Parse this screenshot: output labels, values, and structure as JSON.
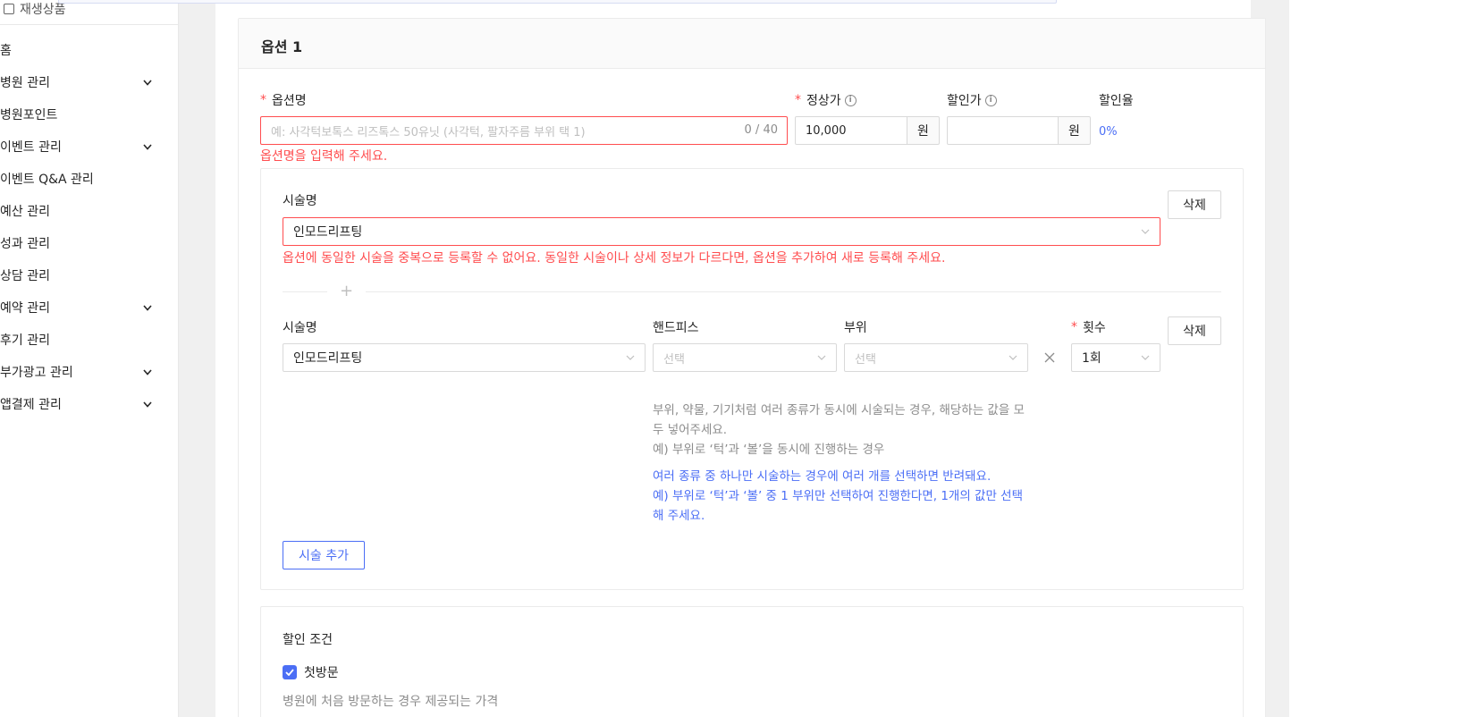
{
  "sidebar": {
    "top_label": "재생상품",
    "items": [
      {
        "label": "홈",
        "expandable": false
      },
      {
        "label": "병원 관리",
        "expandable": true
      },
      {
        "label": "병원포인트",
        "expandable": false
      },
      {
        "label": "이벤트 관리",
        "expandable": true
      },
      {
        "label": "이벤트 Q&A 관리",
        "expandable": false
      },
      {
        "label": "예산 관리",
        "expandable": false
      },
      {
        "label": "성과 관리",
        "expandable": false
      },
      {
        "label": "상담 관리",
        "expandable": false
      },
      {
        "label": "예약 관리",
        "expandable": true
      },
      {
        "label": "후기 관리",
        "expandable": false
      },
      {
        "label": "부가광고 관리",
        "expandable": true
      },
      {
        "label": "앱결제 관리",
        "expandable": true
      }
    ]
  },
  "option": {
    "title": "옵션 1",
    "name_label": "옵션명",
    "name_placeholder": "예: 사각턱보톡스 리즈톡스 50유닛 (사각턱, 팔자주름 부위 택 1)",
    "name_counter": "0 / 40",
    "name_error": "옵션명을 입력해 주세요.",
    "price_label": "정상가",
    "price_value": "10,000",
    "price_unit": "원",
    "discount_label": "할인가",
    "discount_value": "",
    "discount_unit": "원",
    "rate_label": "할인율",
    "rate_value": "0%"
  },
  "procedure1": {
    "label": "시술명",
    "value": "인모드리프팅",
    "error": "옵션에 동일한 시술을 중복으로 등록할 수 없어요. 동일한 시술이나 상세 정보가 다르다면, 옵션을 추가하여 새로 등록해 주세요.",
    "delete_label": "삭제"
  },
  "procedure2": {
    "label": "시술명",
    "value": "인모드리프팅",
    "handpiece_label": "핸드피스",
    "handpiece_placeholder": "선택",
    "area_label": "부위",
    "area_placeholder": "선택",
    "count_label": "횟수",
    "count_value": "1회",
    "delete_label": "삭제"
  },
  "hints": {
    "gray1": "부위, 약물, 기기처럼 여러 종류가 동시에 시술되는 경우, 해당하는 값을 모두 넣어주세요.",
    "gray2": "예) 부위로 ‘턱’과 ‘볼’을 동시에 진행하는 경우",
    "blue1": "여러 종류 중 하나만 시술하는 경우에 여러 개를 선택하면 반려돼요.",
    "blue2": "예) 부위로 ‘턱’과 ‘볼’ 중 1 부위만 선택하여 진행한다면, 1개의 값만 선택해 주세요."
  },
  "add_procedure_label": "시술 추가",
  "discount": {
    "title": "할인 조건",
    "first_visit_label": "첫방문",
    "first_visit_checked": true,
    "first_visit_desc": "병원에 처음 방문하는 경우 제공되는 가격"
  },
  "colors": {
    "accent": "#4b6ef5",
    "error": "#ff4d4f"
  }
}
